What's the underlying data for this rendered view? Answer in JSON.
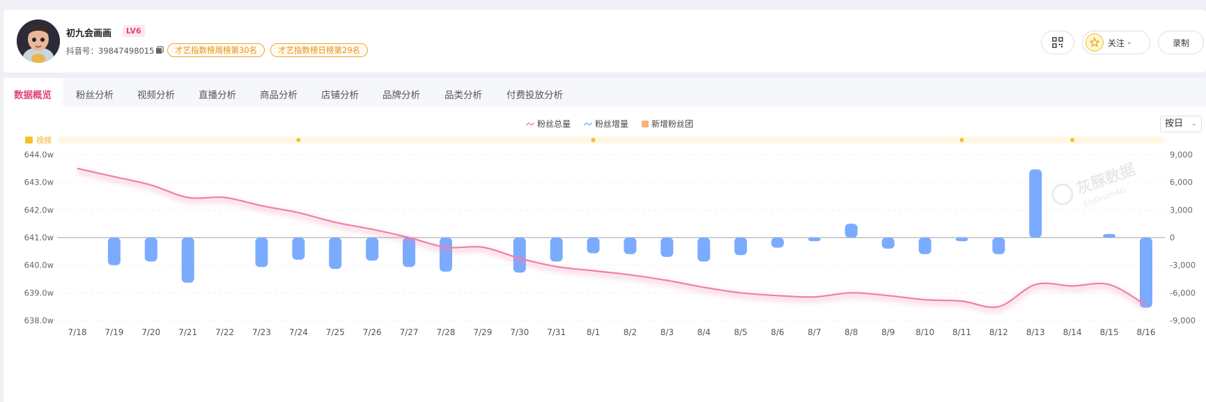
{
  "profile": {
    "name": "初九会画画",
    "level": "LV6",
    "douyin_id": "抖音号：39847498015",
    "ranks": [
      "才艺指数榜周榜第30名",
      "才艺指数榜日榜第29名"
    ]
  },
  "actions": {
    "follow_label": "关注",
    "record_label": "录制"
  },
  "tabs": [
    "数据概览",
    "粉丝分析",
    "视频分析",
    "直播分析",
    "商品分析",
    "店铺分析",
    "品牌分析",
    "品类分析",
    "付费投放分析"
  ],
  "active_tab": 0,
  "legend": [
    "粉丝总量",
    "粉丝增量",
    "新增粉丝团"
  ],
  "granularity": "按日",
  "watermark": {
    "cn": "灰豚数据",
    "en": "ElaGnizhAG"
  },
  "colors": {
    "total": "#f07fa8",
    "increase": "#7aabff",
    "club": "#f7b27b",
    "video": "#f3c124",
    "active_tab": "#e0467a"
  },
  "chart_data": {
    "type": "bar+line",
    "video_row_label": "视频",
    "video_markers": [
      "7/24",
      "8/1",
      "8/11",
      "8/14"
    ],
    "categories": [
      "7/18",
      "7/19",
      "7/20",
      "7/21",
      "7/22",
      "7/23",
      "7/24",
      "7/25",
      "7/26",
      "7/27",
      "7/28",
      "7/29",
      "7/30",
      "7/31",
      "8/1",
      "8/2",
      "8/3",
      "8/4",
      "8/5",
      "8/6",
      "8/7",
      "8/8",
      "8/9",
      "8/10",
      "8/11",
      "8/12",
      "8/13",
      "8/14",
      "8/15",
      "8/16"
    ],
    "y_left_ticks": [
      "644.0w",
      "643.0w",
      "642.0w",
      "641.0w",
      "640.0w",
      "639.0w",
      "638.0w"
    ],
    "y_left_range": [
      638.0,
      644.0
    ],
    "y_right_ticks": [
      "9,000",
      "6,000",
      "3,000",
      "0",
      "-3,000",
      "-6,000",
      "-9,000"
    ],
    "y_right_range": [
      -9000,
      9000
    ],
    "series": [
      {
        "name": "粉丝总量",
        "axis": "left",
        "values": [
          643.5,
          643.2,
          642.9,
          642.45,
          642.45,
          642.15,
          641.9,
          641.55,
          641.3,
          641.0,
          640.65,
          640.65,
          640.25,
          639.95,
          639.8,
          639.65,
          639.45,
          639.2,
          639.0,
          638.9,
          638.85,
          639.0,
          638.9,
          638.75,
          638.7,
          638.5,
          639.3,
          639.25,
          639.3,
          638.55
        ]
      },
      {
        "name": "粉丝增量",
        "axis": "right",
        "values": [
          0,
          -3000,
          -2600,
          -4900,
          0,
          -3200,
          -2400,
          -3400,
          -2500,
          -3200,
          -3700,
          0,
          -3800,
          -2600,
          -1700,
          -1800,
          -2100,
          -2600,
          -1900,
          -1100,
          -400,
          1500,
          -1200,
          -1800,
          -400,
          -1800,
          7400,
          0,
          400,
          -7600
        ]
      },
      {
        "name": "新增粉丝团",
        "axis": "right",
        "values": []
      }
    ]
  }
}
